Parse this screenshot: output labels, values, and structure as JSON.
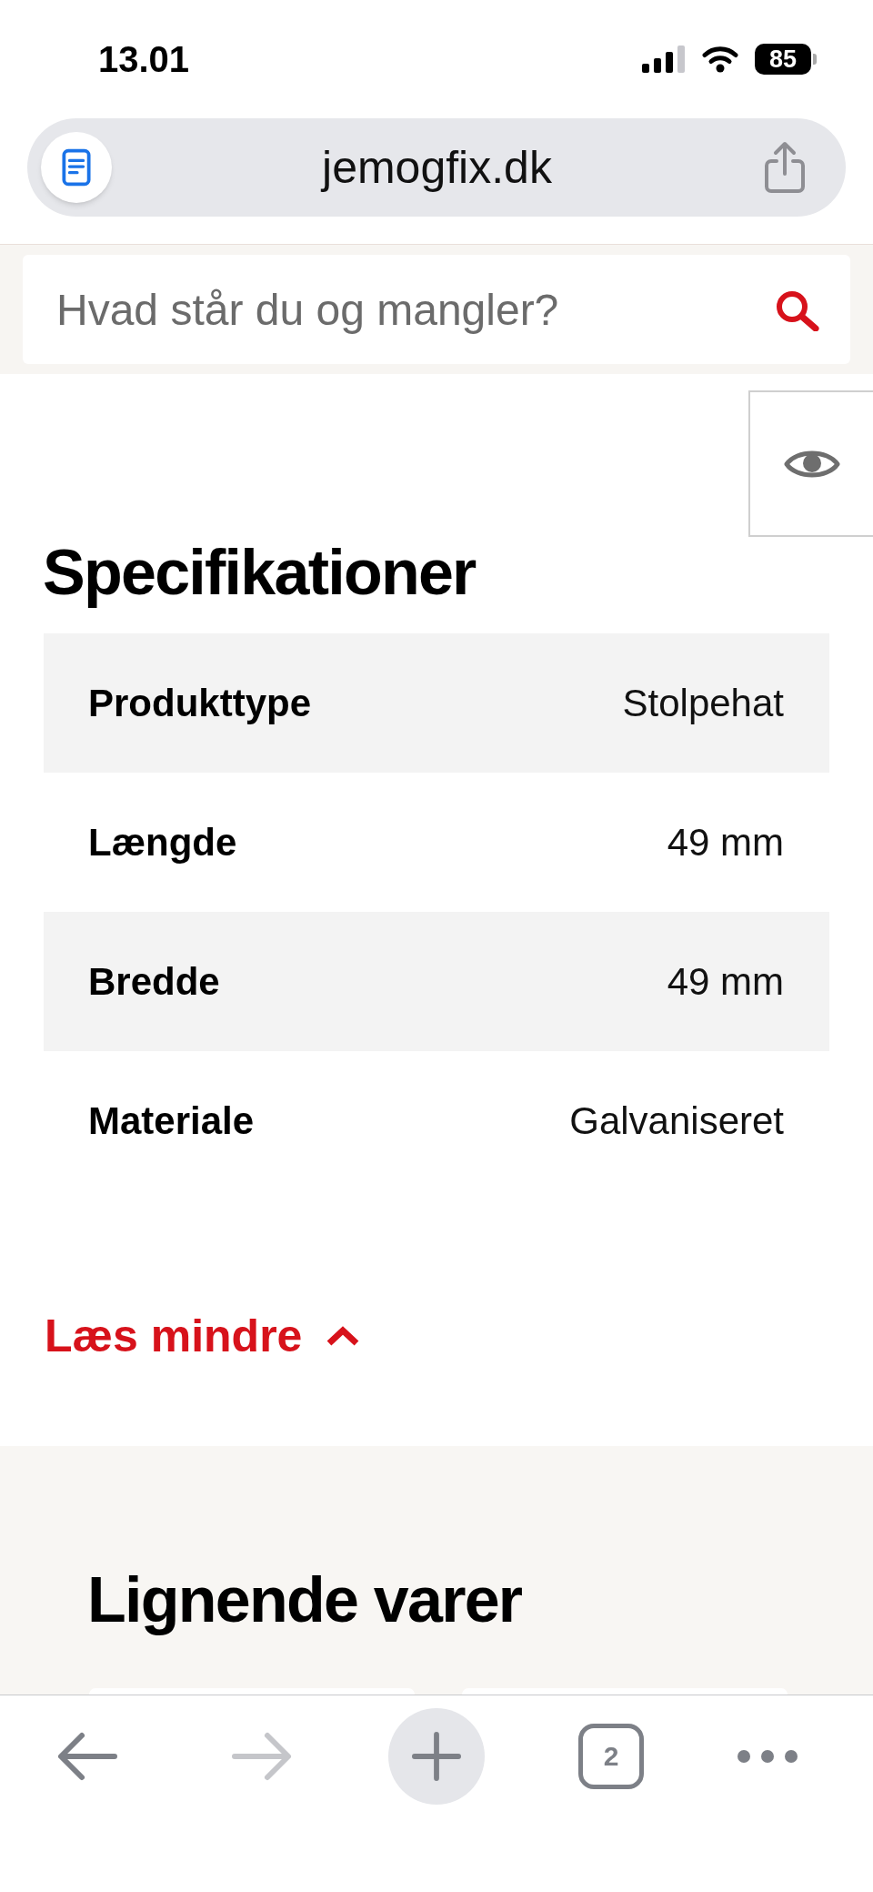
{
  "status_bar": {
    "time": "13.01",
    "battery": "85"
  },
  "browser": {
    "url": "jemogfix.dk"
  },
  "search": {
    "placeholder": "Hvad står du og mangler?"
  },
  "specifications": {
    "title": "Specifikationer",
    "rows": [
      {
        "label": "Produkttype",
        "value": "Stolpehat"
      },
      {
        "label": "Længde",
        "value": "49 mm"
      },
      {
        "label": "Bredde",
        "value": "49 mm"
      },
      {
        "label": "Materiale",
        "value": "Galvaniseret"
      }
    ]
  },
  "read_less": {
    "label": "Læs mindre"
  },
  "similar_products": {
    "title": "Lignende varer"
  },
  "toolbar": {
    "buttons": [
      {
        "kind": "back",
        "disabled": false
      },
      {
        "kind": "forward",
        "disabled": true
      },
      {
        "kind": "new_tab",
        "disabled": false
      },
      {
        "kind": "tabs",
        "label": "2",
        "disabled": false
      },
      {
        "kind": "more",
        "disabled": false
      }
    ]
  }
}
